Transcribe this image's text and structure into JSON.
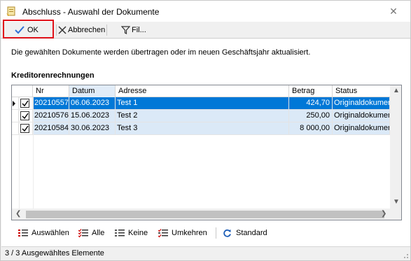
{
  "window": {
    "title": "Abschluss - Auswahl der Dokumente"
  },
  "toolbar": {
    "ok_label": "OK",
    "cancel_label": "Abbrechen",
    "filter_label": "Fil..."
  },
  "info_text": "Die gewählten Dokumente werden übertragen oder im neuen Geschäftsjahr aktualisiert.",
  "section_title": "Kreditorenrechnungen",
  "grid": {
    "columns": [
      "Nr",
      "Datum",
      "Adresse",
      "Betrag",
      "Status"
    ],
    "rows": [
      {
        "nr": "20210557",
        "datum": "06.06.2023",
        "adresse": "Test 1",
        "betrag": "424,70",
        "status": "Originaldokument",
        "checked": true,
        "selected": true
      },
      {
        "nr": "20210576",
        "datum": "15.06.2023",
        "adresse": "Test 2",
        "betrag": "250,00",
        "status": "Originaldokument",
        "checked": true,
        "selected": false
      },
      {
        "nr": "20210584",
        "datum": "30.06.2023",
        "adresse": "Test 3",
        "betrag": "8 000,00",
        "status": "Originaldokument",
        "checked": true,
        "selected": false
      }
    ]
  },
  "actions": {
    "auswaehlen": "Auswählen",
    "alle": "Alle",
    "keine": "Keine",
    "umkehren": "Umkehren",
    "standard": "Standard"
  },
  "status_bar": "3 / 3 Ausgewähltes Elemente",
  "colors": {
    "selection": "#0078d7",
    "alt_row": "#dbe9f7",
    "highlight_border": "#e0121a",
    "ok_check": "#2f6fd6"
  }
}
